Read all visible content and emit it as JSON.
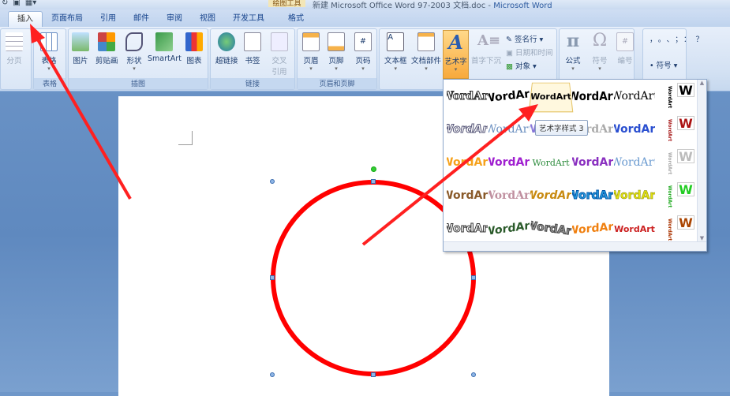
{
  "title": {
    "doc": "新建 Microsoft Office Word 97-2003 文档.doc",
    "sep": " - ",
    "app": "Microsoft Word",
    "context_tab": "绘图工具"
  },
  "tabs": [
    "插入",
    "页面布局",
    "引用",
    "邮件",
    "审阅",
    "视图",
    "开发工具",
    "格式"
  ],
  "groups": {
    "page": "",
    "table": "表格",
    "illustrations": "插图",
    "links": "链接",
    "header_footer": "页眉和页脚"
  },
  "buttons": {
    "page_break": "分页",
    "table": "表格",
    "picture": "图片",
    "clipart": "剪贴画",
    "shapes": "形状",
    "smartart": "SmartArt",
    "chart": "图表",
    "hyperlink": "超链接",
    "bookmark": "书签",
    "cross_ref": "交叉引用",
    "header": "页眉",
    "footer": "页脚",
    "page_number": "页码",
    "textbox": "文本框",
    "quick_parts": "文档部件",
    "wordart": "艺术字",
    "dropcap": "首字下沉",
    "signature": "签名行 ▾",
    "datetime": "日期和时间",
    "object": "对象 ▾",
    "equation": "公式",
    "symbol": "符号",
    "number": "编号",
    "special_symbol": "符号 ▾",
    "sym_chars": "，。、；：？"
  },
  "gallery": {
    "sample": "WordArt",
    "tooltip": "艺术字样式 3",
    "w": "W"
  },
  "colors": {
    "arrow": "#ff2020",
    "circle": "#ff0000"
  }
}
